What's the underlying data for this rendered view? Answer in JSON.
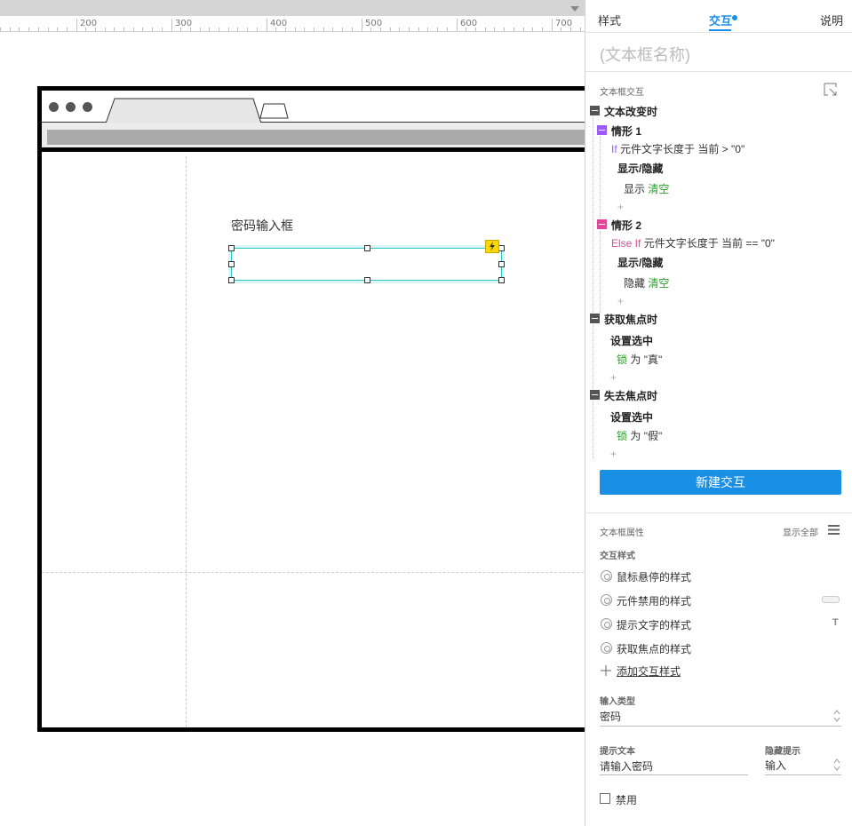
{
  "ruler": {
    "labels": [
      "200",
      "300",
      "400",
      "500",
      "600",
      "700"
    ]
  },
  "canvas": {
    "widget_label": "密码输入框"
  },
  "panel": {
    "tabs": {
      "style": "样式",
      "interactions": "交互",
      "notes": "说明"
    },
    "name_placeholder": "(文本框名称)",
    "interactions_heading": "文本框交互",
    "events": {
      "text_changed": {
        "title": "文本改变时",
        "case1": {
          "title": "情形 1",
          "cond_kw": "If",
          "cond": "元件文字长度于 当前 > \"0\"",
          "action": "显示/隐藏",
          "detail_verb": "显示",
          "detail_target": "清空"
        },
        "case2": {
          "title": "情形 2",
          "cond_kw": "Else If",
          "cond": "元件文字长度于 当前 == \"0\"",
          "action": "显示/隐藏",
          "detail_verb": "隐藏",
          "detail_target": "清空"
        }
      },
      "focus": {
        "title": "获取焦点时",
        "action": "设置选中",
        "detail_target": "锁",
        "detail_rest": "为 \"真\""
      },
      "blur": {
        "title": "失去焦点时",
        "action": "设置选中",
        "detail_target": "锁",
        "detail_rest": "为 \"假\""
      }
    },
    "plus": "+",
    "new_interaction_button": "新建交互",
    "props_heading": "文本框属性",
    "show_all": "显示全部",
    "interaction_styles_heading": "交互样式",
    "styles": [
      "鼠标悬停的样式",
      "元件禁用的样式",
      "提示文字的样式",
      "获取焦点的样式"
    ],
    "style_t_glyph": "T",
    "add_style_link": "添加交互样式",
    "input_type": {
      "label": "输入类型",
      "value": "密码"
    },
    "hint_text": {
      "label": "提示文本",
      "value": "请输入密码"
    },
    "hide_hint": {
      "label": "隐藏提示",
      "value": "输入"
    },
    "disabled_checkbox": "禁用"
  }
}
